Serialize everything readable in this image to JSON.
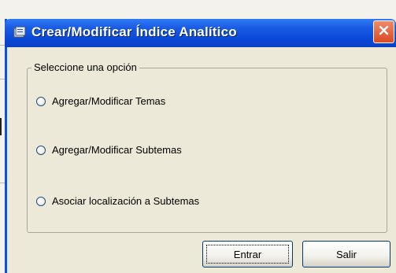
{
  "window": {
    "title": "Crear/Modificar Índice Analítico",
    "icon": "window-app-icon",
    "close_icon": "close-icon"
  },
  "group": {
    "legend": "Seleccione una opción",
    "options": [
      {
        "label": "Agregar/Modificar Temas",
        "selected": false
      },
      {
        "label": "Agregar/Modificar Subtemas",
        "selected": false
      },
      {
        "label": "Asociar localización a Subtemas",
        "selected": false
      }
    ]
  },
  "buttons": {
    "enter": "Entrar",
    "exit": "Salir"
  },
  "colors": {
    "titlebar": "#0a48d6",
    "dialog_bg": "#ece9d8",
    "close_button": "#d94a22"
  }
}
